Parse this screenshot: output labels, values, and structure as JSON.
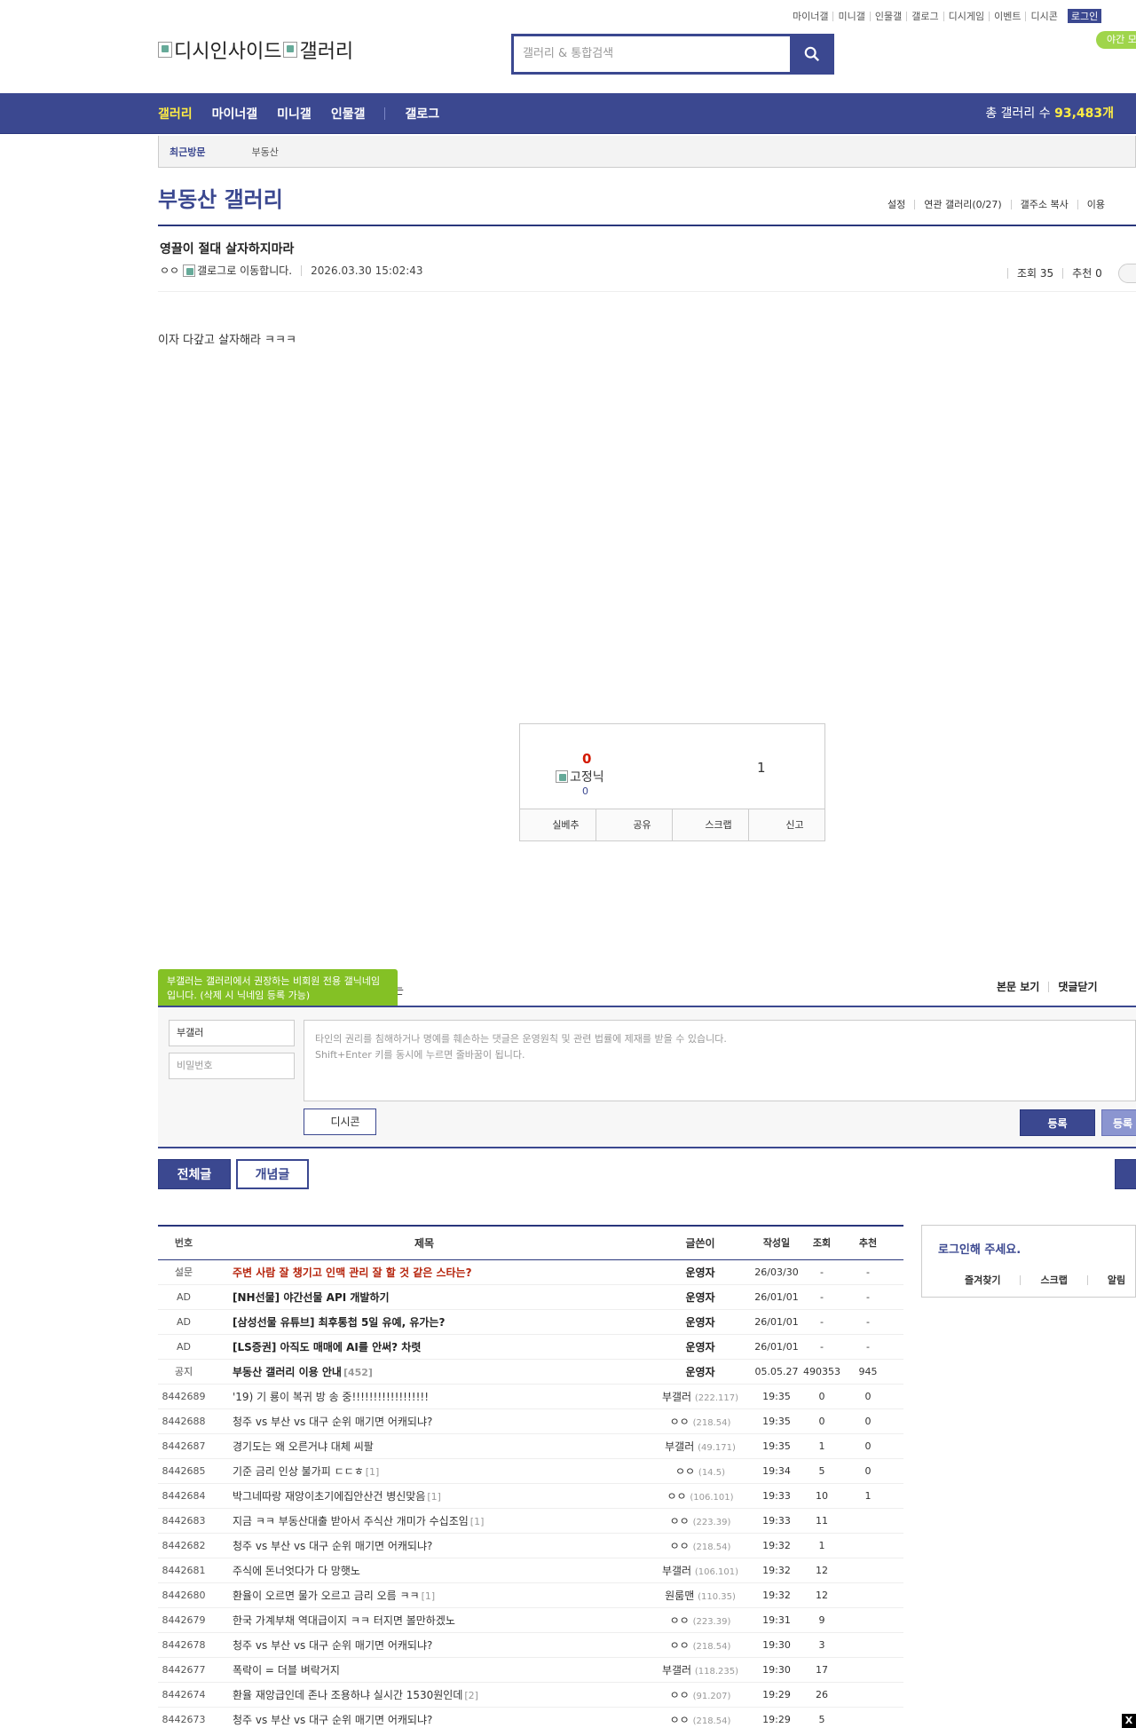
{
  "util_links": [
    "마이너갤",
    "미니갤",
    "인물갤",
    "갤로그",
    "디시게임",
    "이벤트",
    "디시콘"
  ],
  "login_label": "로그인",
  "night_mode": "야간 모",
  "logo": {
    "site": "디시인사이드",
    "gallery": "갤러리"
  },
  "search": {
    "placeholder": "갤러리 & 통합검색"
  },
  "gnb": {
    "items": [
      "갤러리",
      "마이너갤",
      "미니갤",
      "인물갤"
    ],
    "gallog": "갤로그",
    "total_label": "총 갤러리 수",
    "total_value": "93,483개"
  },
  "recent": {
    "label": "최근방문",
    "item": "부동산"
  },
  "page_title": "부동산 갤러리",
  "title_tools": [
    "설정",
    "연관 갤러리(0/27)",
    "갤주소 복사",
    "이용"
  ],
  "post": {
    "title": "영끌이 절대 살자하지마라",
    "author": "ㅇㅇ",
    "gallog_alt": "갤로그로 이동합니다.",
    "date": "2026.03.30 15:02:43",
    "views": "조회 35",
    "recommend": "추천 0",
    "body": "이자 다갚고 살자해라 ㅋㅋㅋ"
  },
  "recommend_box": {
    "up": "0",
    "fixed_nick_alt": "고정닉",
    "fixed_count": "0",
    "down": "1",
    "buttons": [
      "실베추",
      "공유",
      "스크랩",
      "신고"
    ]
  },
  "comment": {
    "tooltip": "부갤러는 갤러리에서 권장하는 비회원 전용 갤닉네임입니다. (삭제 시 닉네임 등록 가능)",
    "label_tail": "는",
    "tools": [
      "본문 보기",
      "댓글닫기"
    ],
    "nick_value": "부갤러",
    "pw_placeholder": "비밀번호",
    "notice_line1": "타인의 권리를 침해하거나 명예를 훼손하는 댓글은 운영원칙 및 관련 법률에 제재를 받을 수 있습니다.",
    "notice_line2": "Shift+Enter 키를 동시에 누르면 줄바꿈이 됩니다.",
    "dccon": "디시콘",
    "register": "등록",
    "register2": "등록"
  },
  "list_tabs": [
    "전체글",
    "개념글"
  ],
  "table": {
    "headers": [
      "번호",
      "제목",
      "글쓴이",
      "작성일",
      "조회",
      "추천"
    ],
    "rows": [
      {
        "num": "설문",
        "title": "주변 사람 잘 챙기고 인맥 관리 잘 할 것 같은 스타는?",
        "cc": "",
        "writer": "운영자",
        "ip": "",
        "date": "26/03/30",
        "views": "-",
        "rec": "-",
        "style": "notice"
      },
      {
        "num": "AD",
        "title": "[NH선물] 야간선물 API 개발하기",
        "cc": "",
        "writer": "운영자",
        "ip": "",
        "date": "26/01/01",
        "views": "-",
        "rec": "-",
        "style": "bold"
      },
      {
        "num": "AD",
        "title": "[삼성선물 유튜브] 최후통첩 5일 유예, 유가는?",
        "cc": "",
        "writer": "운영자",
        "ip": "",
        "date": "26/01/01",
        "views": "-",
        "rec": "-",
        "style": "bold"
      },
      {
        "num": "AD",
        "title": "[LS증권] 아직도 매매에 AI를 안써? 차렷",
        "cc": "",
        "writer": "운영자",
        "ip": "",
        "date": "26/01/01",
        "views": "-",
        "rec": "-",
        "style": "bold"
      },
      {
        "num": "공지",
        "title": "부동산 갤러리 이용 안내",
        "cc": "[452]",
        "writer": "운영자",
        "ip": "",
        "date": "05.05.27",
        "views": "490353",
        "rec": "945",
        "style": "bold"
      },
      {
        "num": "8442689",
        "title": "'19) 기 룡이 복귀 방 송 중!!!!!!!!!!!!!!!!!!",
        "cc": "",
        "writer": "부갤러",
        "ip": "(222.117)",
        "date": "19:35",
        "views": "0",
        "rec": "0",
        "style": ""
      },
      {
        "num": "8442688",
        "title": "청주 vs 부산 vs 대구 순위 매기면 어캐되냐?",
        "cc": "",
        "writer": "ㅇㅇ",
        "ip": "(218.54)",
        "date": "19:35",
        "views": "0",
        "rec": "0",
        "style": ""
      },
      {
        "num": "8442687",
        "title": "경기도는 왜 오른거냐 대체 씨팔",
        "cc": "",
        "writer": "부갤러",
        "ip": "(49.171)",
        "date": "19:35",
        "views": "1",
        "rec": "0",
        "style": ""
      },
      {
        "num": "8442685",
        "title": "기준 금리 인상 불가피 ㄷㄷㅎ",
        "cc": "[1]",
        "writer": "ㅇㅇ",
        "ip": "(14.5)",
        "date": "19:34",
        "views": "5",
        "rec": "0",
        "style": ""
      },
      {
        "num": "8442684",
        "title": "박그네따랑 재앙이초기에집안산건 병신맞음",
        "cc": "[1]",
        "writer": "ㅇㅇ",
        "ip": "(106.101)",
        "date": "19:33",
        "views": "10",
        "rec": "1",
        "style": ""
      },
      {
        "num": "8442683",
        "title": "지금 ㅋㅋ 부동산대출 받아서 주식산 개미가 수십조임",
        "cc": "[1]",
        "writer": "ㅇㅇ",
        "ip": "(223.39)",
        "date": "19:33",
        "views": "11",
        "rec": "",
        "style": ""
      },
      {
        "num": "8442682",
        "title": "청주 vs 부산 vs 대구 순위 매기면 어캐되냐?",
        "cc": "",
        "writer": "ㅇㅇ",
        "ip": "(218.54)",
        "date": "19:32",
        "views": "1",
        "rec": "",
        "style": ""
      },
      {
        "num": "8442681",
        "title": "주식에 돈너엇다가 다 망햇노",
        "cc": "",
        "writer": "부갤러",
        "ip": "(106.101)",
        "date": "19:32",
        "views": "12",
        "rec": "",
        "style": ""
      },
      {
        "num": "8442680",
        "title": "환율이 오르면 물가 오르고 금리 오름 ㅋㅋ",
        "cc": "[1]",
        "writer": "원룸맨",
        "ip": "(110.35)",
        "date": "19:32",
        "views": "12",
        "rec": "",
        "style": ""
      },
      {
        "num": "8442679",
        "title": "한국 가계부채 역대급이지 ㅋㅋ 터지면 볼만하겠노",
        "cc": "",
        "writer": "ㅇㅇ",
        "ip": "(223.39)",
        "date": "19:31",
        "views": "9",
        "rec": "",
        "style": ""
      },
      {
        "num": "8442678",
        "title": "청주 vs 부산 vs 대구 순위 매기면 어캐되냐?",
        "cc": "",
        "writer": "ㅇㅇ",
        "ip": "(218.54)",
        "date": "19:30",
        "views": "3",
        "rec": "",
        "style": ""
      },
      {
        "num": "8442677",
        "title": "폭락이 = 더블 벼락거지",
        "cc": "",
        "writer": "부갤러",
        "ip": "(118.235)",
        "date": "19:30",
        "views": "17",
        "rec": "",
        "style": ""
      },
      {
        "num": "8442674",
        "title": "환율 재앙급인데 존나 조용하냐 실시간 1530원인데",
        "cc": "[2]",
        "writer": "ㅇㅇ",
        "ip": "(91.207)",
        "date": "19:29",
        "views": "26",
        "rec": "",
        "style": ""
      },
      {
        "num": "8442673",
        "title": "청주 vs 부산 vs 대구 순위 매기면 어캐되냐?",
        "cc": "",
        "writer": "ㅇㅇ",
        "ip": "(218.54)",
        "date": "19:29",
        "views": "5",
        "rec": "",
        "style": ""
      }
    ]
  },
  "login_panel": {
    "title": "로그인해 주세요.",
    "links": [
      "즐겨찾기",
      "스크랩",
      "알림"
    ]
  },
  "close_x": "X"
}
